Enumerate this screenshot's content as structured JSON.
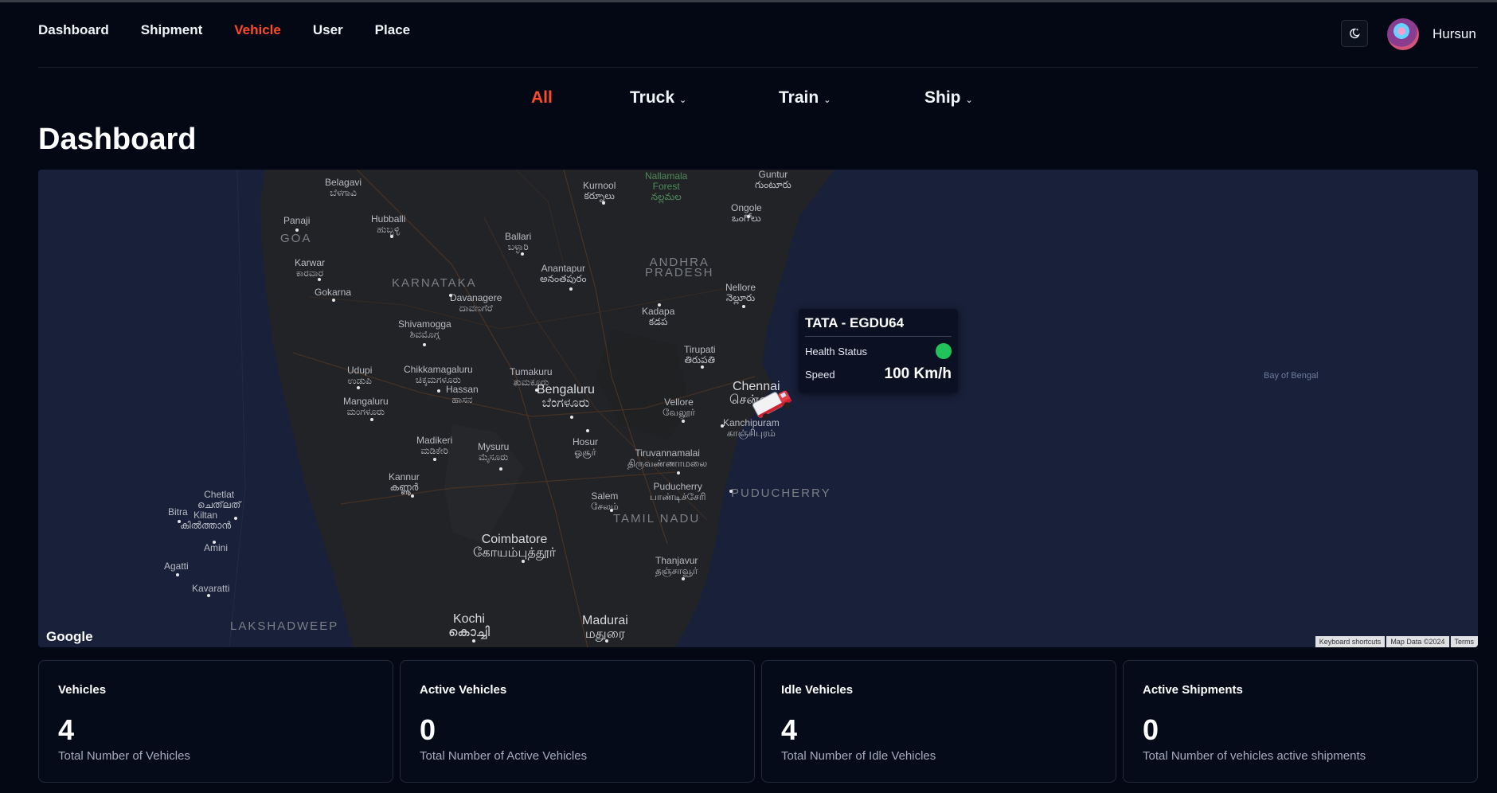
{
  "nav": {
    "items": [
      {
        "label": "Dashboard",
        "active": false
      },
      {
        "label": "Shipment",
        "active": false
      },
      {
        "label": "Vehicle",
        "active": true
      },
      {
        "label": "User",
        "active": false
      },
      {
        "label": "Place",
        "active": false
      }
    ],
    "active_color": "#ff4a2e",
    "theme_toggle_icon": "moon-stars-icon"
  },
  "user": {
    "name": "Hursun"
  },
  "tabs": [
    {
      "label": "All",
      "active": true,
      "dropdown": false
    },
    {
      "label": "Truck",
      "active": false,
      "dropdown": true
    },
    {
      "label": "Train",
      "active": false,
      "dropdown": true
    },
    {
      "label": "Ship",
      "active": false,
      "dropdown": true
    }
  ],
  "page_title": "Dashboard",
  "map": {
    "labels": {
      "guntur": "Guntur\nగుంటూరు",
      "kurnool": "Kurnool\nకర్నూలు",
      "nallamala": "Nallamala\nForest\nనల్లమల",
      "belagavi": "Belagavi\nಬೆಳಗಾವಿ",
      "hubballi": "Hubballi\nಹುಬ್ಬಳ್ಳಿ",
      "panaji": "Panaji",
      "goa": "GOA",
      "ongole": "Ongole\nఒంగోలు",
      "ballari": "Ballari\nಬಳ್ಳಾರಿ",
      "andhra": "ANDHRA\nPRADESH",
      "karwar": "Karwar\nಕಾರವಾರ",
      "anantapur": "Anantapur\nఅనంతపురం",
      "karnataka": "KARNATAKA",
      "gokarna": "Gokarna",
      "davanagere": "Davanagere\nದಾವಣಗೆರೆ",
      "nellore": "Nellore\nనెల్లూరు",
      "kadapa": "Kadapa\nకడప",
      "shivamogga": "Shivamogga\nಶಿವಮೊಗ್ಗ",
      "tirupati": "Tirupati\nతిరుపతి",
      "udupi": "Udupi\nಉಡುಪಿ",
      "chikkamagaluru": "Chikkamagaluru\nಚಿಕ್ಕಮಗಳೂರು",
      "tumakuru": "Tumakuru\nತುಮಕೂರು",
      "bengaluru": "Bengaluru\nಬೆಂಗಳೂರು",
      "chennai": "Chennai\nசென்னை",
      "hassan": "Hassan\nಹಾಸನ",
      "mangaluru": "Mangaluru\nಮಂಗಳೂರು",
      "vellore": "Vellore\nவேலூர்",
      "kanchipuram": "Kanchipuram\nகாஞ்சிபுரம்",
      "madikeri": "Madikeri\nಮಡಿಕೇರಿ",
      "hosur": "Hosur\nஓசூர்",
      "mysuru": "Mysuru\nಮೈಸೂರು",
      "tiruvannamalai": "Tiruvannamalai\nதிருவண்ணாமலை",
      "kannur": "Kannur\nകണ്ണൂർ",
      "puducherry_city": "Puducherry\nபாண்டிச்சேரி",
      "puducherry": "PUDUCHERRY",
      "chetlat": "Chetlat\nചെത്‌ലത്",
      "salem": "Salem\nசேலம்",
      "bitra": "Bitra",
      "kiltan": "Kiltan\nകിൽത്താൻ",
      "tamilnadu": "TAMIL NADU",
      "amini": "Amini",
      "coimbatore": "Coimbatore\nகோயம்புத்தூர்",
      "agatti": "Agatti",
      "thanjavur": "Thanjavur\nதஞ்சாவூர்",
      "kavaratti": "Kavaratti",
      "lakshadweep": "LAKSHADWEEP",
      "kochi": "Kochi\nകൊച്ചി",
      "madurai": "Madurai\nமதுரை",
      "bay": "Bay of Bengal"
    },
    "google_logo": "Google",
    "attribution": [
      "Keyboard shortcuts",
      "Map Data ©2024",
      "Terms"
    ],
    "popup": {
      "title": "TATA - EGDU64",
      "health_label": "Health Status",
      "health_color": "#21c45a",
      "speed_label": "Speed",
      "speed_value": "100 Km/h"
    },
    "marker_icon": "truck-icon"
  },
  "stats": [
    {
      "title": "Vehicles",
      "value": "4",
      "subtitle": "Total Number of Vehicles"
    },
    {
      "title": "Active Vehicles",
      "value": "0",
      "subtitle": "Total Number of Active Vehicles"
    },
    {
      "title": "Idle Vehicles",
      "value": "4",
      "subtitle": "Total Number of Idle Vehicles"
    },
    {
      "title": "Active Shipments",
      "value": "0",
      "subtitle": "Total Number of vehicles active shipments"
    }
  ]
}
